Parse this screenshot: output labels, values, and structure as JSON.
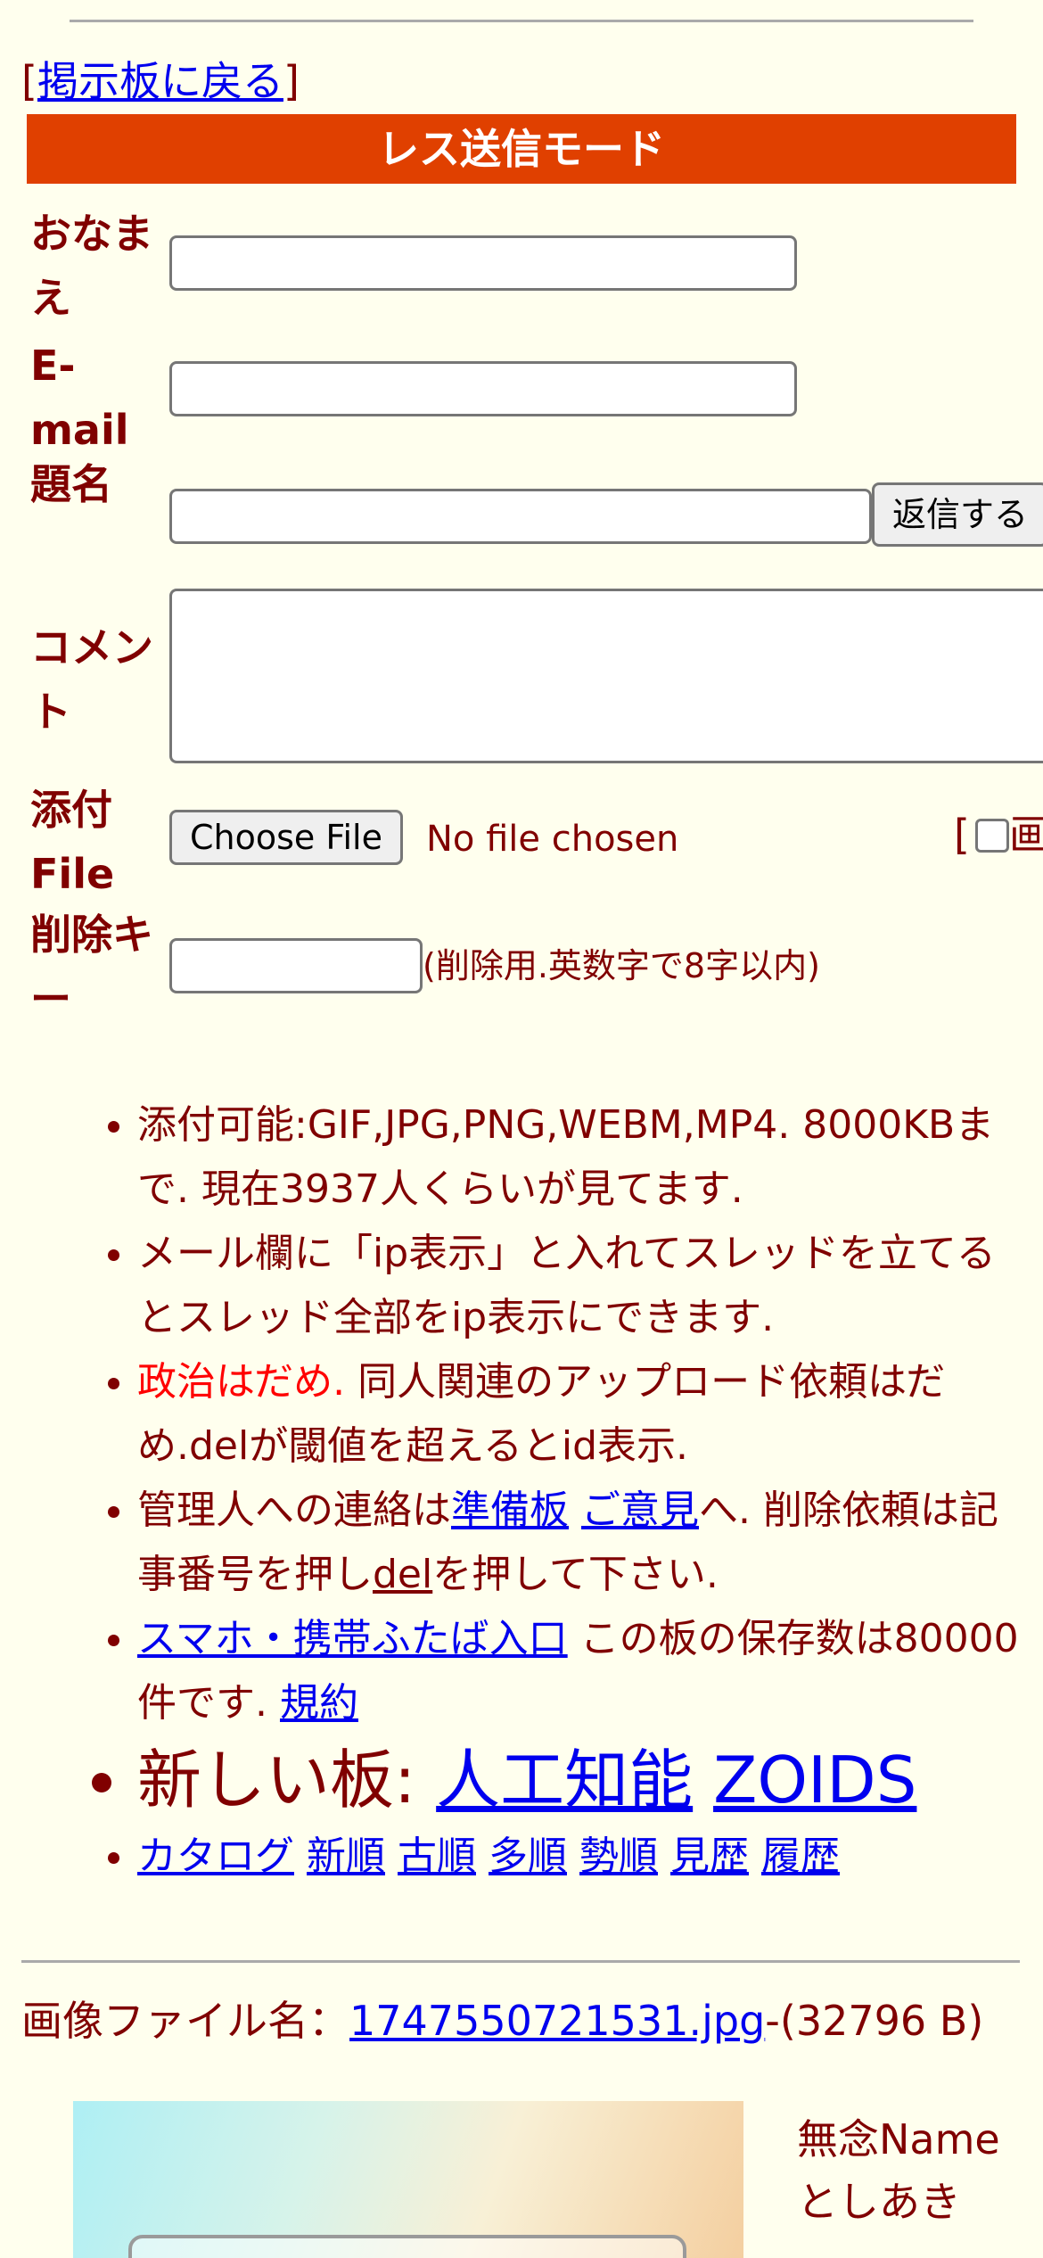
{
  "nav": {
    "back_open": "[",
    "back_link": "掲示板に戻る",
    "back_close": "]"
  },
  "form": {
    "mode_title": "レス送信モード",
    "name_label": "おなまえ",
    "email_label": "E-mail",
    "subject_label": "題名",
    "submit_button": "返信する",
    "comment_label": "コメント",
    "file_label": "添付File",
    "choose_file_button": "Choose File",
    "file_status": "No file chosen",
    "image_toggle_open": "[",
    "image_toggle_label": "画",
    "delete_key_label": "削除キー",
    "delete_key_hint": "(削除用.英数字で8字以内)"
  },
  "notes": {
    "n1": "添付可能:GIF,JPG,PNG,WEBM,MP4. 8000KBまで. 現在3937人くらいが見てます.",
    "n2": "メール欄に「ip表示」と入れてスレッドを立てるとスレッド全部をip表示にできます.",
    "n3_warning": "政治はだめ.",
    "n3_rest": " 同人関連のアップロード依頼はだめ.delが閾値を超えるとid表示.",
    "n4_prefix": "管理人への連絡は",
    "n4_link1": "準備板",
    "n4_link2": "ご意見",
    "n4_mid": "へ. 削除依頼は記事番号を押し",
    "n4_link3": "del",
    "n4_suffix": "を押して下さい.",
    "n5_link": "スマホ・携帯ふたば入口",
    "n5_text": " この板の保存数は80000件です. ",
    "n5_terms": "規約",
    "new_boards_label": "新しい板: ",
    "new_board_1": "人工知能",
    "new_board_2": "ZOIDS",
    "sort_links": [
      "カタログ",
      "新順",
      "古順",
      "多順",
      "勢順",
      "見歴",
      "履歴"
    ]
  },
  "post": {
    "file_label": "画像ファイル名：",
    "file_name": "1747550721531.jpg",
    "file_size": "-(32796 B)",
    "name": "無念Name",
    "poster": "としあき"
  },
  "colors": {
    "background": "#FFFFEE",
    "text": "#800000",
    "mode_bar": "#E04000",
    "link": "#0000EE",
    "warning": "#FF0000"
  }
}
